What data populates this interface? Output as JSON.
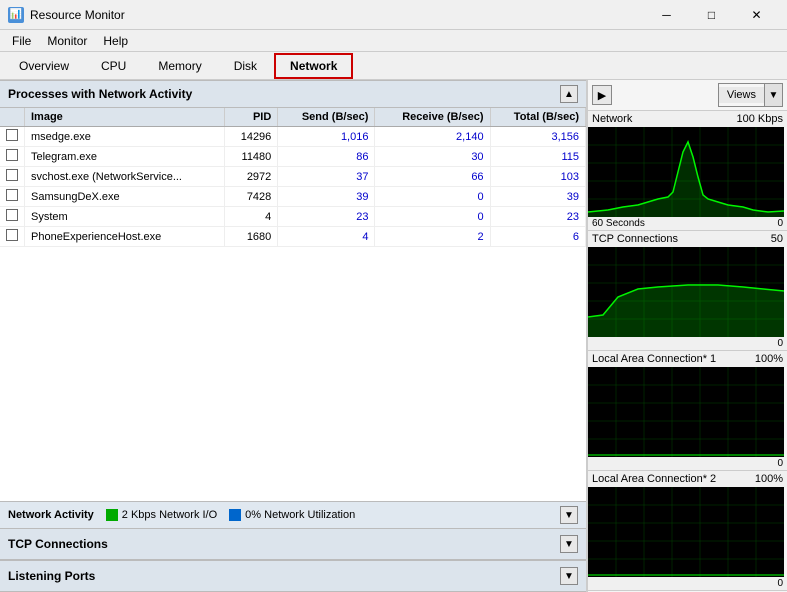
{
  "titleBar": {
    "title": "Resource Monitor",
    "minBtn": "─",
    "maxBtn": "□",
    "closeBtn": "✕"
  },
  "menuBar": {
    "items": [
      "File",
      "Monitor",
      "Help"
    ]
  },
  "tabs": {
    "items": [
      "Overview",
      "CPU",
      "Memory",
      "Disk",
      "Network"
    ],
    "active": "Network"
  },
  "processes": {
    "sectionTitle": "Processes with Network Activity",
    "columns": {
      "image": "Image",
      "pid": "PID",
      "send": "Send (B/sec)",
      "receive": "Receive (B/sec)",
      "total": "Total (B/sec)"
    },
    "rows": [
      {
        "image": "msedge.exe",
        "pid": "14296",
        "send": "1,016",
        "receive": "2,140",
        "total": "3,156"
      },
      {
        "image": "Telegram.exe",
        "pid": "11480",
        "send": "86",
        "receive": "30",
        "total": "115"
      },
      {
        "image": "svchost.exe (NetworkService...",
        "pid": "2972",
        "send": "37",
        "receive": "66",
        "total": "103"
      },
      {
        "image": "SamsungDeX.exe",
        "pid": "7428",
        "send": "39",
        "receive": "0",
        "total": "39"
      },
      {
        "image": "System",
        "pid": "4",
        "send": "23",
        "receive": "0",
        "total": "23"
      },
      {
        "image": "PhoneExperienceHost.exe",
        "pid": "1680",
        "send": "4",
        "receive": "2",
        "total": "6"
      }
    ]
  },
  "networkActivity": {
    "sectionTitle": "Network Activity",
    "legend1": "2 Kbps Network I/O",
    "legend2": "0% Network Utilization"
  },
  "tcpConnections": {
    "sectionTitle": "TCP Connections"
  },
  "listeningPorts": {
    "sectionTitle": "Listening Ports"
  },
  "rightPanel": {
    "viewsLabel": "Views",
    "charts": [
      {
        "label": "Network",
        "value": "100 Kbps",
        "bottomLeft": "60 Seconds",
        "bottomRight": "0"
      },
      {
        "label": "TCP Connections",
        "value": "50",
        "bottomLeft": "",
        "bottomRight": "0"
      },
      {
        "label": "Local Area Connection* 1",
        "value": "100%",
        "bottomLeft": "",
        "bottomRight": "0"
      },
      {
        "label": "Local Area Connection* 2",
        "value": "100%",
        "bottomLeft": "",
        "bottomRight": "0"
      }
    ]
  }
}
